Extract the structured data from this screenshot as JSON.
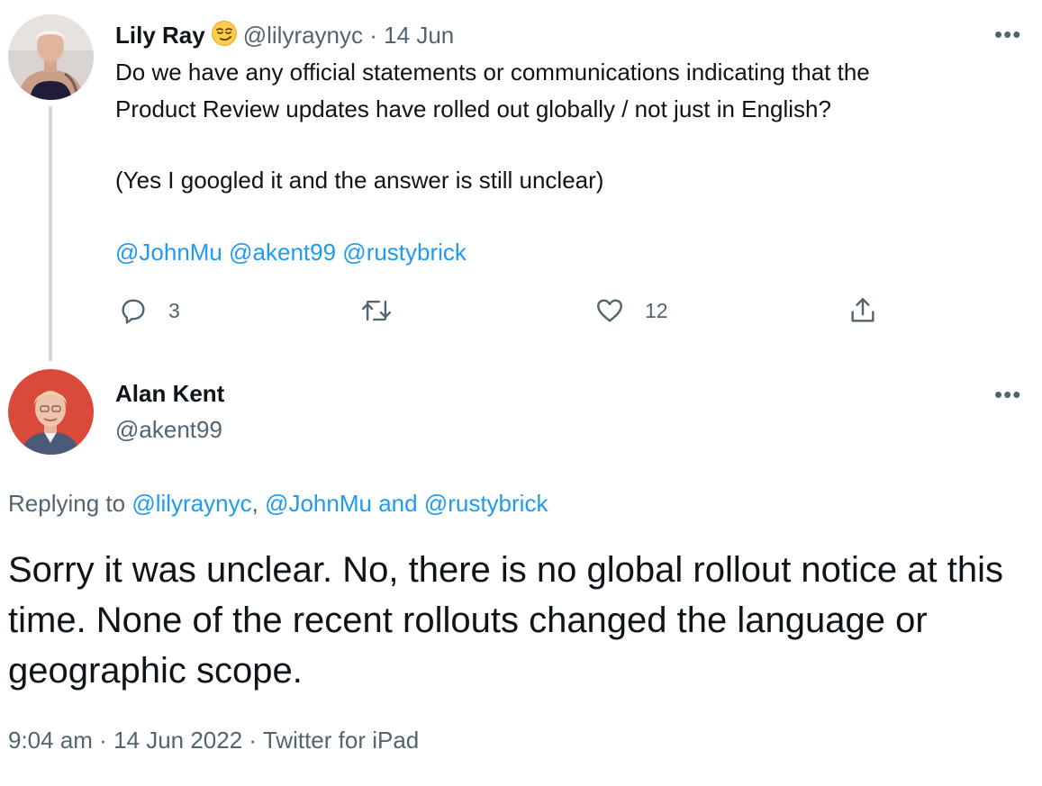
{
  "tweet1": {
    "display_name": "Lily Ray",
    "emoji": "smirking-face",
    "handle": "@lilyraynyc",
    "separator": "·",
    "date": "14 Jun",
    "more": "•••",
    "line1": "Do we have any official statements or communications indicating that the",
    "line2": "Product Review updates have rolled out globally / not just in English?",
    "line3": "(Yes I googled it and the answer is still unclear)",
    "mentions": [
      "@JohnMu",
      "@akent99",
      "@rustybrick"
    ],
    "actions": {
      "reply_icon": "reply-icon",
      "reply_count": "3",
      "retweet_icon": "retweet-icon",
      "like_icon": "heart-icon",
      "like_count": "12",
      "share_icon": "share-icon"
    }
  },
  "tweet2": {
    "display_name": "Alan Kent",
    "handle": "@akent99",
    "more": "•••",
    "replying_to_prefix": "Replying to ",
    "replying_to_1": "@lilyraynyc",
    "replying_comma": ", ",
    "replying_to_2": "@JohnMu",
    "replying_and": " and ",
    "replying_to_3": "@rustybrick",
    "text": "Sorry it was unclear. No, there is no global rollout notice at this time. None of the recent rollouts changed the language or geographic scope.",
    "time": "9:04 am",
    "meta_sep": " · ",
    "date": "14 Jun 2022",
    "source": "Twitter for iPad"
  },
  "colors": {
    "link": "#1d9bf0",
    "muted": "#536471",
    "text": "#0f1419",
    "thread_line": "#cfd9de"
  }
}
